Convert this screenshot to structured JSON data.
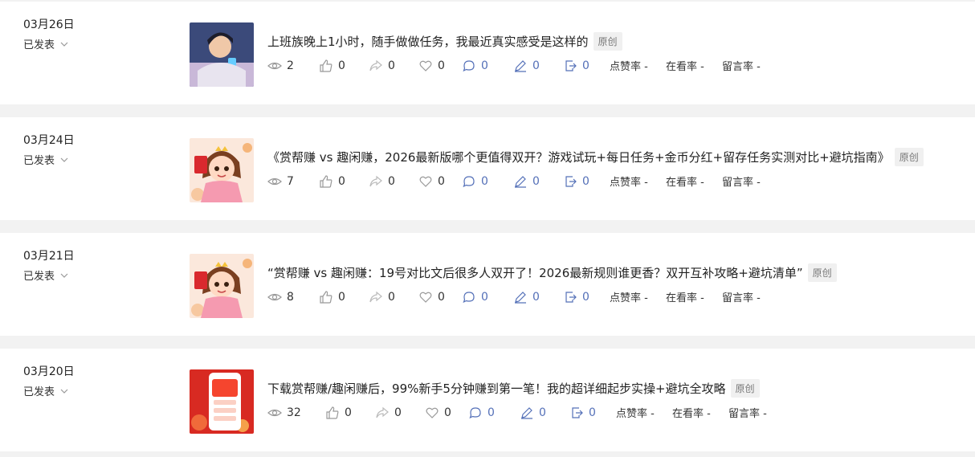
{
  "rows": [
    {
      "date": "03月26日",
      "status": "已发表",
      "title": "上班族晚上1小时，随手做做任务，我最近真实感受是这样的",
      "tag": "原创",
      "thumb": "night-phone",
      "views": "2",
      "likes": "0",
      "shares": "0",
      "favs": "0",
      "comments": "0",
      "notes": "0",
      "exports": "0",
      "rate_like": "点赞率 -",
      "rate_watch": "在看率 -",
      "rate_comment": "留言率 -"
    },
    {
      "date": "03月24日",
      "status": "已发表",
      "title": "《赏帮赚 vs 趣闲赚，2026最新版哪个更值得双开？游戏试玩+每日任务+金币分红+留存任务实测对比+避坑指南》",
      "tag": "原创",
      "thumb": "girl-redpacket",
      "views": "7",
      "likes": "0",
      "shares": "0",
      "favs": "0",
      "comments": "0",
      "notes": "0",
      "exports": "0",
      "rate_like": "点赞率 -",
      "rate_watch": "在看率 -",
      "rate_comment": "留言率 -"
    },
    {
      "date": "03月21日",
      "status": "已发表",
      "title": "“赏帮赚 vs 趣闲赚：19号对比文后很多人双开了！2026最新规则谁更香？双开互补攻略+避坑清单”",
      "tag": "原创",
      "thumb": "girl-redpacket",
      "views": "8",
      "likes": "0",
      "shares": "0",
      "favs": "0",
      "comments": "0",
      "notes": "0",
      "exports": "0",
      "rate_like": "点赞率 -",
      "rate_watch": "在看率 -",
      "rate_comment": "留言率 -"
    },
    {
      "date": "03月20日",
      "status": "已发表",
      "title": "下载赏帮赚/趣闲赚后，99%新手5分钟赚到第一笔！我的超详细起步实操+避坑全攻略",
      "tag": "原创",
      "thumb": "phone-app",
      "views": "32",
      "likes": "0",
      "shares": "0",
      "favs": "0",
      "comments": "0",
      "notes": "0",
      "exports": "0",
      "rate_like": "点赞率 -",
      "rate_watch": "在看率 -",
      "rate_comment": "留言率 -"
    }
  ]
}
